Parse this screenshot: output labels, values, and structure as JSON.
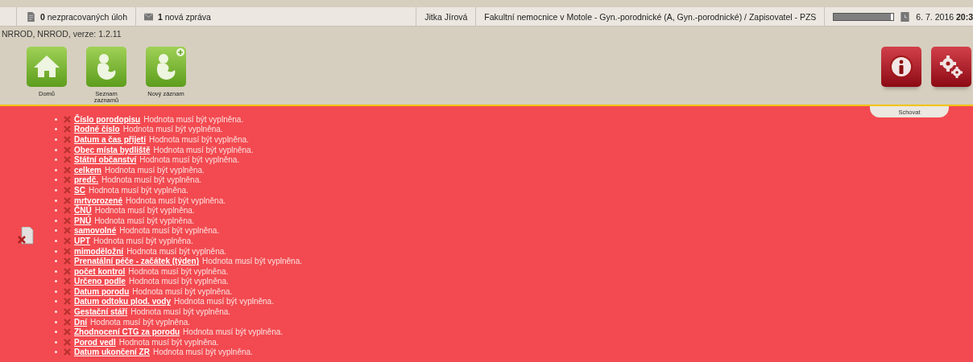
{
  "top_bar": {
    "tasks": "**0** nezpracovaných úloh",
    "messages": "**1** nová zpráva",
    "user": "Jitka Jírová",
    "workplace": "Fakultní nemocnice v Motole - Gyn.-porodnické (A, Gyn.-porodnické) / Zapisovatel - PZS",
    "session": {
      "level": 0.96
    },
    "datetime": "6. 7. 2016 **20:3**"
  },
  "version": "NRROD, NRROD, verze: 1.2.11",
  "toolbar": [
    {
      "kind": "home",
      "label": "Domů"
    },
    {
      "kind": "records",
      "label": "Seznam zaznamů"
    },
    {
      "kind": "new_record",
      "label": "Nový záznam"
    }
  ],
  "actions": [
    {
      "kind": "info"
    },
    {
      "kind": "settings"
    }
  ],
  "hide_tab": "Schovat",
  "errors": [
    {
      "field": "Číslo porodopisu",
      "message": "Hodnota musí být vyplněna."
    },
    {
      "field": "Rodné číslo",
      "message": "Hodnota musí být vyplněna."
    },
    {
      "field": "Datum a čas přijetí",
      "message": "Hodnota musí být vyplněna."
    },
    {
      "field": "Obec místa bydliště",
      "message": "Hodnota musí být vyplněna."
    },
    {
      "field": "Státní občanství",
      "message": "Hodnota musí být vyplněna."
    },
    {
      "field": "celkem",
      "message": "Hodnota musí být vyplněna."
    },
    {
      "field": "predč.",
      "message": "Hodnota musí být vyplněna."
    },
    {
      "field": "SC",
      "message": "Hodnota musí být vyplněna."
    },
    {
      "field": "mrtvorozené",
      "message": "Hodnota musí být vyplněna."
    },
    {
      "field": "ČNÚ",
      "message": "Hodnota musí být vyplněna."
    },
    {
      "field": "PNÚ",
      "message": "Hodnota musí být vyplněna."
    },
    {
      "field": "samovolné",
      "message": "Hodnota musí být vyplněna."
    },
    {
      "field": "UPT",
      "message": "Hodnota musí být vyplněna."
    },
    {
      "field": "mimoděložní",
      "message": "Hodnota musí být vyplněna."
    },
    {
      "field": "Prenatální péče - začátek (týden)",
      "message": "Hodnota musí být vyplněna."
    },
    {
      "field": "počet kontrol",
      "message": "Hodnota musí být vyplněna."
    },
    {
      "field": "Určeno podle",
      "message": "Hodnota musí být vyplněna."
    },
    {
      "field": "Datum porodu",
      "message": "Hodnota musí být vyplněna."
    },
    {
      "field": "Datum odtoku plod. vody",
      "message": "Hodnota musí být vyplněna."
    },
    {
      "field": "Gestační stáří",
      "message": "Hodnota musí být vyplněna."
    },
    {
      "field": "Dní",
      "message": "Hodnota musí být vyplněna."
    },
    {
      "field": "Zhodnocení CTG za porodu",
      "message": "Hodnota musí být vyplněna."
    },
    {
      "field": "Porod vedl",
      "message": "Hodnota musí být vyplněna."
    },
    {
      "field": "Datum ukončení ZR",
      "message": "Hodnota musí být vyplněna."
    }
  ]
}
